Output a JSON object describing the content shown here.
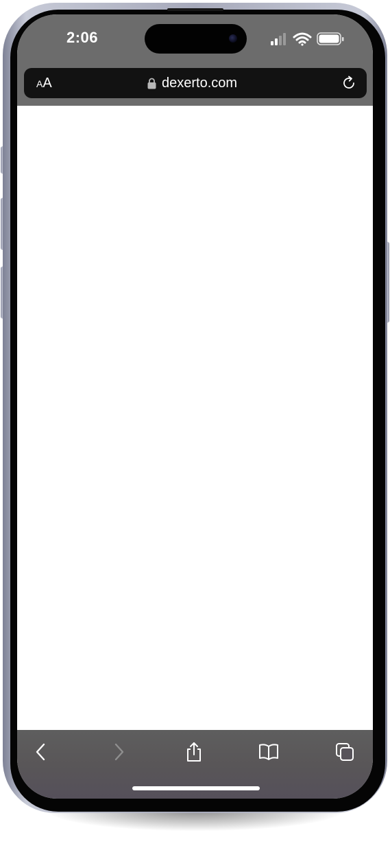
{
  "status_bar": {
    "time": "2:06",
    "signal_icon": "cellular-signal-icon",
    "wifi_icon": "wifi-icon",
    "battery_icon": "battery-icon"
  },
  "address_bar": {
    "text_size_label": "AA",
    "lock_icon": "lock-icon",
    "url": "dexerto.com",
    "reload_icon": "reload-icon"
  },
  "toolbar": {
    "back_icon": "chevron-left-icon",
    "forward_icon": "chevron-right-icon",
    "share_icon": "share-icon",
    "bookmarks_icon": "book-icon",
    "tabs_icon": "tabs-icon"
  },
  "colors": {
    "browser_chrome": "#6c6c6c",
    "address_bar": "#121212",
    "page_background": "#ffffff",
    "bezel": "#050505",
    "frame": "#a6a9ba"
  }
}
